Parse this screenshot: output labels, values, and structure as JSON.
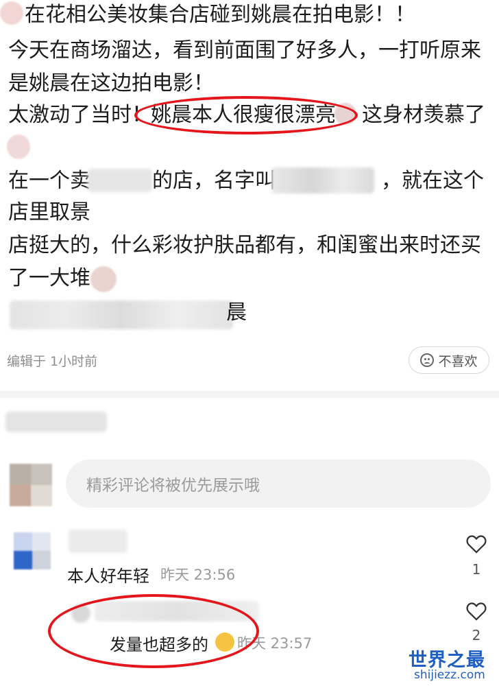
{
  "post": {
    "line1": "在花相公美妆集合店碰到姚晨在拍电影！！",
    "line2": "今天在商场溜达，看到前面围了好多人，一打听原来",
    "line3": "是姚晨在这边拍电影！",
    "line4a": "太激动了当时！",
    "line4b": "姚晨本人很瘦很漂亮",
    "line4c": "这身材羡慕了",
    "line5a": "在一个卖",
    "line5b": "的店，名字叫",
    "line5c": "，就在这个",
    "line6": "店里取景",
    "line7": "店挺大的，什么彩妆护肤品都有，和闺蜜出来时还买",
    "line8": "了一大堆",
    "line9_tail": "晨"
  },
  "meta": {
    "edited": "编辑于 1小时前",
    "dislike_label": "不喜欢"
  },
  "comment_input": {
    "placeholder": "精彩评论将被优先展示哦"
  },
  "comments": [
    {
      "text": "本人好年轻",
      "time": "昨天 23:56",
      "likes": "1"
    },
    {
      "text": "发量也超多的",
      "time": "昨天 23:57",
      "likes": "2"
    }
  ],
  "watermark": {
    "cn": "世界之最",
    "en": "shijiezz.com"
  },
  "colors": {
    "highlight": "#e5161b",
    "watermark": "#1f5fc4"
  }
}
